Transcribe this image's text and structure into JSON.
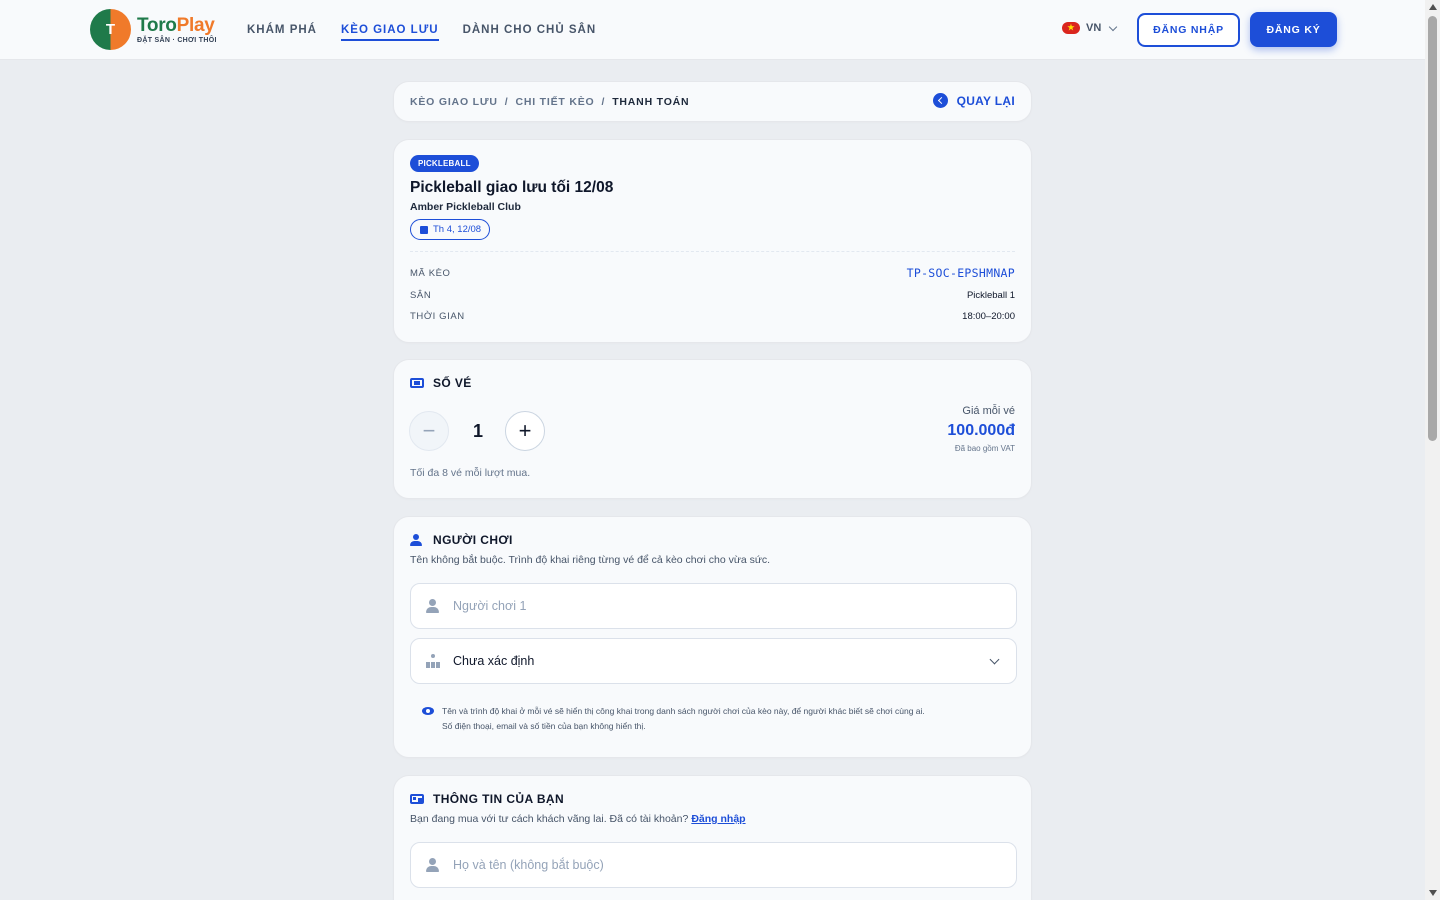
{
  "header": {
    "logo_initial": "T",
    "brand_part1": "Toro",
    "brand_part2": "Play",
    "tagline": "ĐẶT SÂN · CHƠI THÔI",
    "nav": [
      "KHÁM PHÁ",
      "KÈO GIAO LƯU",
      "DÀNH CHO CHỦ SÂN"
    ],
    "active_nav": "KÈO GIAO LƯU",
    "lang": "VN",
    "login": "ĐĂNG NHẬP",
    "register": "ĐĂNG KÝ"
  },
  "breadcrumb": {
    "items": [
      "KÈO GIAO LƯU",
      "CHI TIẾT KÈO",
      "THANH TOÁN"
    ],
    "sep": "/",
    "back": "QUAY LẠI"
  },
  "match": {
    "badge": "PICKLEBALL",
    "title": "Pickleball giao lưu tối 12/08",
    "club": "Amber Pickleball Club",
    "date": "Th 4, 12/08",
    "rows": [
      {
        "label": "MÃ KÈO",
        "value": "TP-SOC-EPSHMNAP"
      },
      {
        "label": "SÂN",
        "value": "Pickleball 1"
      },
      {
        "label": "THỜI GIAN",
        "value": "18:00–20:00"
      }
    ]
  },
  "tickets": {
    "heading": "SỐ VÉ",
    "quantity": "1",
    "minus": "−",
    "plus": "+",
    "price_label": "Giá mỗi vé",
    "price": "100.000đ",
    "vat": "Đã bao gồm VAT",
    "max_note": "Tối đa 8 vé mỗi lượt mua."
  },
  "players": {
    "heading": "NGƯỜI CHƠI",
    "subtitle": "Tên không bắt buộc. Trình độ khai riêng từng vé để cả kèo chơi cho vừa sức.",
    "name_placeholder": "Người chơi 1",
    "level_value": "Chưa xác định",
    "privacy_line1": "Tên và trình độ khai ở mỗi vé sẽ hiển thị công khai trong danh sách người chơi của kèo này, để người khác biết sẽ chơi cùng ai.",
    "privacy_line2": "Số điện thoại, email và số tiền của bạn không hiển thị."
  },
  "you": {
    "heading": "THÔNG TIN CỦA BẠN",
    "subtitle": "Bạn đang mua với tư cách khách vãng lai. Đã có tài khoản?",
    "login_link": "Đăng nhập",
    "name_placeholder": "Họ và tên (không bắt buộc)"
  },
  "colors": {
    "accent": "#1d4ed8",
    "brand_green": "#1f7a4a",
    "brand_orange": "#f07a2a",
    "background": "#eaedf1"
  },
  "icons": [
    "chevron-left-icon",
    "calendar-icon",
    "ticket-icon",
    "user-edit-icon",
    "user-icon",
    "level-icon",
    "chevron-down-icon",
    "eye-icon",
    "id-card-icon",
    "flag-vn-icon"
  ]
}
